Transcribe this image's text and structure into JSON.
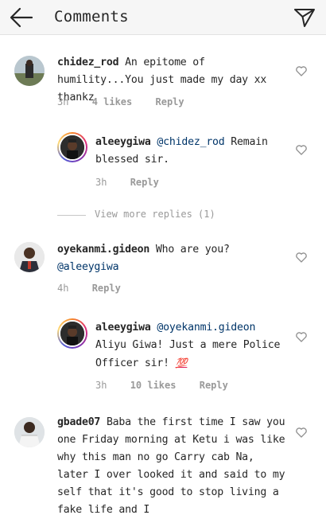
{
  "header": {
    "title": "Comments",
    "back_icon": "arrow-left-icon",
    "send_icon": "send-icon"
  },
  "comments": [
    {
      "username": "chidez_rod",
      "text": "An epitome of humility...You just made my day xx thankz",
      "time": "3h",
      "likes": "4 likes",
      "reply": "Reply"
    },
    {
      "username": "aleeygiwa",
      "mention": "@chidez_rod",
      "text": "Remain blessed sir.",
      "time": "3h",
      "reply": "Reply"
    },
    {
      "username": "oyekanmi.gideon",
      "text": "Who are you?",
      "mention": "@aleeygiwa",
      "time": "4h",
      "reply": "Reply"
    },
    {
      "username": "aleeygiwa",
      "mention": "@oyekanmi.gideon",
      "text": "Aliyu Giwa! Just a mere Police Officer sir!",
      "emoji": "💯",
      "time": "3h",
      "likes": "10 likes",
      "reply": "Reply"
    },
    {
      "username": "gbade07",
      "text": "Baba the first time I saw you one Friday morning at Ketu i was like why this man no go Carry cab Na, later I over  looked it and said to my self that it's good to stop living a fake life and I"
    }
  ],
  "view_more": "View more replies (1)",
  "colors": {
    "mention": "#003569",
    "meta": "#999999",
    "header_bg": "#f6f6f6"
  }
}
